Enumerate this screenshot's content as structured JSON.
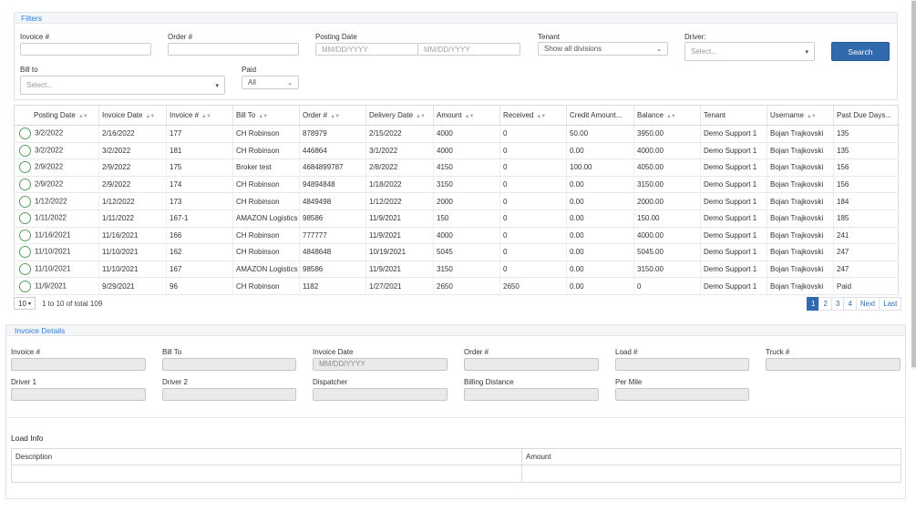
{
  "filters": {
    "title": "Filters",
    "invoice_label": "Invoice #",
    "order_label": "Order #",
    "posting_date_label": "Posting Date",
    "date_from_placeholder": "MM/DD/YYYY",
    "date_to_placeholder": "MM/DD/YYYY",
    "tenant_label": "Tenant",
    "tenant_value": "Show all divisions",
    "driver_label": "Driver:",
    "driver_placeholder": "Select...",
    "bill_to_label": "Bill to",
    "bill_to_placeholder": "Select...",
    "paid_label": "Paid",
    "paid_value": "All",
    "search_button": "Search"
  },
  "grid": {
    "columns": [
      "Posting Date",
      "Invoice Date",
      "Invoice #",
      "Bill To",
      "Order #",
      "Delivery Date",
      "Amount",
      "Received",
      "Credit Amount...",
      "Balance",
      "Tenant",
      "Username",
      "Past Due Days..."
    ],
    "rows": [
      [
        "3/2/2022",
        "2/16/2022",
        "177",
        "CH Robinson",
        "878979",
        "2/15/2022",
        "4000",
        "0",
        "50.00",
        "3950.00",
        "Demo Support 1",
        "Bojan Trajkovski",
        "135"
      ],
      [
        "3/2/2022",
        "3/2/2022",
        "181",
        "CH Robinson",
        "446864",
        "3/1/2022",
        "4000",
        "0",
        "0.00",
        "4000.00",
        "Demo Support 1",
        "Bojan Trajkovski",
        "135"
      ],
      [
        "2/9/2022",
        "2/9/2022",
        "175",
        "Broker test",
        "4684899787",
        "2/8/2022",
        "4150",
        "0",
        "100.00",
        "4050.00",
        "Demo Support 1",
        "Bojan Trajkovski",
        "156"
      ],
      [
        "2/9/2022",
        "2/9/2022",
        "174",
        "CH Robinson",
        "94894848",
        "1/18/2022",
        "3150",
        "0",
        "0.00",
        "3150.00",
        "Demo Support 1",
        "Bojan Trajkovski",
        "156"
      ],
      [
        "1/12/2022",
        "1/12/2022",
        "173",
        "CH Robinson",
        "4849498",
        "1/12/2022",
        "2000",
        "0",
        "0.00",
        "2000.00",
        "Demo Support 1",
        "Bojan Trajkovski",
        "184"
      ],
      [
        "1/11/2022",
        "1/11/2022",
        "167-1",
        "AMAZON Logistics",
        "98586",
        "11/9/2021",
        "150",
        "0",
        "0.00",
        "150.00",
        "Demo Support 1",
        "Bojan Trajkovski",
        "185"
      ],
      [
        "11/16/2021",
        "11/16/2021",
        "166",
        "CH Robinson",
        "777777",
        "11/9/2021",
        "4000",
        "0",
        "0.00",
        "4000.00",
        "Demo Support 1",
        "Bojan Trajkovski",
        "241"
      ],
      [
        "11/10/2021",
        "11/10/2021",
        "162",
        "CH Robinson",
        "4848648",
        "10/19/2021",
        "5045",
        "0",
        "0.00",
        "5045.00",
        "Demo Support 1",
        "Bojan Trajkovski",
        "247"
      ],
      [
        "11/10/2021",
        "11/10/2021",
        "167",
        "AMAZON Logistics",
        "98586",
        "11/9/2021",
        "3150",
        "0",
        "0.00",
        "3150.00",
        "Demo Support 1",
        "Bojan Trajkovski",
        "247"
      ],
      [
        "11/9/2021",
        "9/29/2021",
        "96",
        "CH Robinson",
        "1182",
        "1/27/2021",
        "2650",
        "2650",
        "0.00",
        "0",
        "Demo Support 1",
        "Bojan Trajkovski",
        "Paid"
      ]
    ]
  },
  "pagination": {
    "page_size": "10",
    "info": "1 to 10 of total 109",
    "pages": [
      "1",
      "2",
      "3",
      "4"
    ],
    "next": "Next",
    "last": "Last"
  },
  "details": {
    "title": "Invoice Details",
    "invoice_label": "Invoice #",
    "bill_to_label": "Bill To",
    "invoice_date_label": "Invoice Date",
    "invoice_date_placeholder": "MM/DD/YYYY",
    "order_label": "Order #",
    "load_label": "Load #",
    "truck_label": "Truck #",
    "driver1_label": "Driver 1",
    "driver2_label": "Driver 2",
    "dispatcher_label": "Dispatcher",
    "billing_distance_label": "Billing Distance",
    "per_mile_label": "Per Mile"
  },
  "load_info": {
    "title": "Load Info",
    "col_description": "Description",
    "col_amount": "Amount"
  },
  "colors": {
    "accent": "#2f6aad",
    "panel_title": "#2f7fd4",
    "radio": "#5a9e5a"
  }
}
